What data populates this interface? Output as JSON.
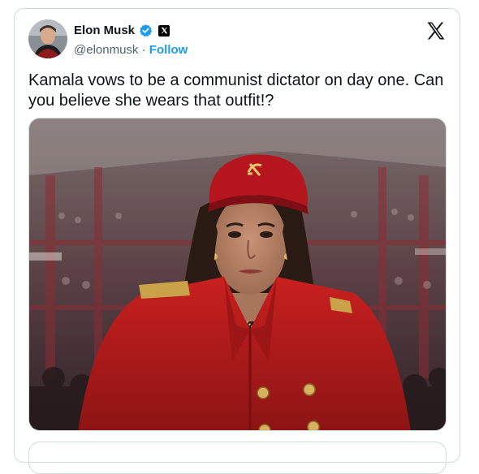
{
  "author": {
    "display_name": "Elon Musk",
    "handle": "@elonmusk",
    "separator": "·",
    "follow_label": "Follow",
    "verified_color": "#1d9bf0"
  },
  "platform_logo": "x-logo-icon",
  "tweet": {
    "text": "Kamala vows to be a communist dictator on day one. Can\nyou believe she wears that outfit!?"
  },
  "media": {
    "icon": "photo-image",
    "colors": {
      "coat": "#b81c1c",
      "cap": "#b5161e",
      "background": "#5a4044",
      "emblem": "#e9c46a"
    }
  }
}
